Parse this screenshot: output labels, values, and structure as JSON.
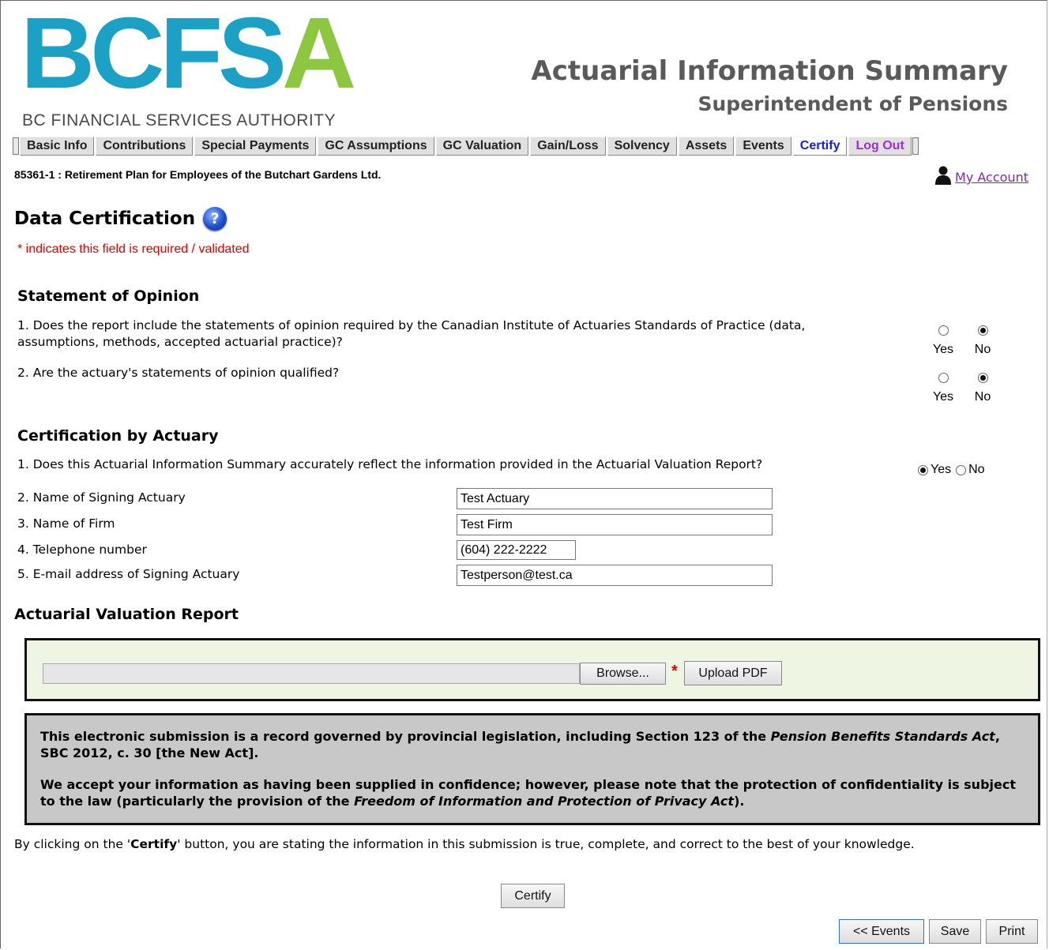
{
  "logo": {
    "main": "BCFS",
    "accent": "A",
    "subtitle": "BC FINANCIAL SERVICES AUTHORITY"
  },
  "header": {
    "title": "Actuarial Information Summary",
    "subtitle": "Superintendent of Pensions"
  },
  "nav": {
    "items": [
      "Basic Info",
      "Contributions",
      "Special Payments",
      "GC Assumptions",
      "GC Valuation",
      "Gain/Loss",
      "Solvency",
      "Assets",
      "Events"
    ],
    "certify": "Certify",
    "logout": "Log Out"
  },
  "plan": {
    "name": "85361-1 : Retirement Plan for Employees of the Butchart Gardens Ltd."
  },
  "account": {
    "label": " My Account",
    "icon": "person-icon"
  },
  "page": {
    "title": "Data Certification",
    "help_icon": "?",
    "required_note": "* indicates this field is required / validated"
  },
  "opinion": {
    "heading": "Statement of Opinion",
    "q1_line1": "1. Does the report include the statements of opinion required by the Canadian Institute of Actuaries Standards of Practice (data,",
    "q1_line2": "assumptions, methods, accepted actuarial practice)?",
    "q2": "2. Are the actuary's statements of opinion qualified?",
    "q1_answer": "No",
    "q2_answer": "No",
    "yes_label": "Yes",
    "no_label": "No"
  },
  "certification": {
    "heading": "Certification by Actuary",
    "q1": "1. Does this Actuarial Information Summary accurately reflect the information provided in the Actuarial Valuation Report?",
    "q1_answer": "Yes",
    "yes_label": "Yes",
    "no_label": "No",
    "q2": "2. Name of Signing Actuary",
    "q3": "3. Name of Firm",
    "q4": "4. Telephone number",
    "q5": "5. E-mail address of Signing Actuary",
    "name_value": "Test Actuary",
    "firm_value": "Test Firm",
    "phone_value": "(604) 222-2222",
    "email_value": "Testperson@test.ca"
  },
  "report": {
    "heading": "Actuarial Valuation Report",
    "browse_label": "Browse...",
    "required_star": "*",
    "upload_label": "Upload PDF"
  },
  "notice": {
    "p1_a": "This electronic submission is a record governed by provincial legislation, including Section 123 of the ",
    "p1_italic": "Pension Benefits Standards Act",
    "p1_b": ", SBC 2012, c. 30 [the New Act].",
    "p2_a": "We accept your information as having been supplied in confidence; however, please note that the protection of confidentiality is subject to the law (particularly the provision of the ",
    "p2_italic": "Freedom of Information and Protection of Privacy Act",
    "p2_b": ")."
  },
  "certify_statement": {
    "a": "By clicking on the '",
    "bold": "Certify",
    "b": "' button, you are stating the information in this submission is true, complete, and correct to the best of your knowledge."
  },
  "buttons": {
    "certify": "Certify",
    "events": "<< Events",
    "save": "Save",
    "print": "Print"
  },
  "colors": {
    "brand_blue": "#1ba1c5",
    "brand_green": "#8dc63f",
    "required_red": "#e00000",
    "upload_bg": "#eef6e3",
    "notice_bg": "#c8c8c8"
  }
}
